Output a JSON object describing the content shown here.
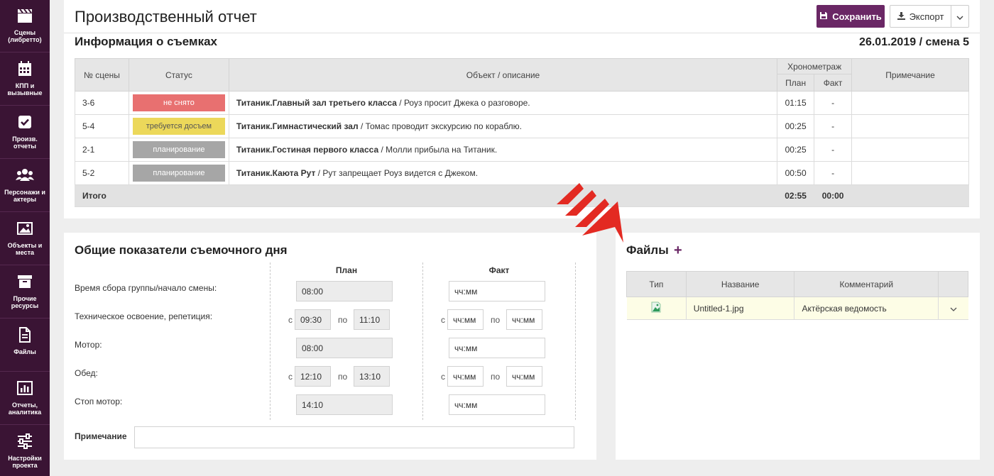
{
  "sidebar": {
    "items": [
      {
        "label": "Сцены\n(либретто)",
        "icon": "clapperboard-icon"
      },
      {
        "label": "КПП и\nвызывные",
        "icon": "calendar-icon"
      },
      {
        "label": "Произв.\nотчеты",
        "icon": "checkbox-icon"
      },
      {
        "label": "Персонажи и\nактеры",
        "icon": "users-icon"
      },
      {
        "label": "Объекты и\nместа",
        "icon": "image-icon"
      },
      {
        "label": "Прочие\nресурсы",
        "icon": "archive-icon"
      },
      {
        "label": "Файлы",
        "icon": "file-icon"
      },
      {
        "label": "Отчеты,\nаналитика",
        "icon": "bar-chart-icon"
      },
      {
        "label": "Настройки\nпроекта",
        "icon": "sliders-icon"
      }
    ]
  },
  "header": {
    "title": "Производственный отчет",
    "save_label": "Сохранить",
    "export_label": "Экспорт"
  },
  "shooting_info": {
    "title": "Информация о съемках",
    "date_shift": "26.01.2019 / смена 5",
    "columns": {
      "scene_no": "№ сцены",
      "status": "Статус",
      "object": "Объект / описание",
      "timing": "Хронометраж",
      "plan": "План",
      "fact": "Факт",
      "note": "Примечание"
    },
    "rows": [
      {
        "scene": "3-6",
        "status": "не снято",
        "status_color": "#e87070",
        "status_text_color": "#ffffff",
        "object": "Титаник.Главный зал третьего класса",
        "desc": " / Роуз просит Джека о разговоре.",
        "plan": "01:15",
        "fact": "-"
      },
      {
        "scene": "5-4",
        "status": "требуется досъем",
        "status_color": "#ecd85a",
        "status_text_color": "#555555",
        "object": "Титаник.Гимнастический зал",
        "desc": " / Томас проводит экскурсию по кораблю.",
        "plan": "00:25",
        "fact": "-"
      },
      {
        "scene": "2-1",
        "status": "планирование",
        "status_color": "#a6a6a6",
        "status_text_color": "#ffffff",
        "object": "Титаник.Гостиная первого класса",
        "desc": " / Молли прибыла на Титаник.",
        "plan": "00:25",
        "fact": "-"
      },
      {
        "scene": "5-2",
        "status": "планирование",
        "status_color": "#a6a6a6",
        "status_text_color": "#ffffff",
        "object": "Титаник.Каюта Рут",
        "desc": " / Рут запрещает Роуз видется с Джеком.",
        "plan": "00:50",
        "fact": "-"
      }
    ],
    "total": {
      "label": "Итого",
      "plan": "02:55",
      "fact": "00:00"
    }
  },
  "day_indicators": {
    "title": "Общие показатели съемочного дня",
    "plan_header": "План",
    "fact_header": "Факт",
    "from_label": "с",
    "to_label": "по",
    "placeholder": "чч:мм",
    "rows": [
      {
        "label": "Время сбора группы/начало смены:",
        "plan": "08:00"
      },
      {
        "label": "Техническое освоение, репетиция:",
        "plan_from": "09:30",
        "plan_to": "11:10"
      },
      {
        "label": "Мотор:",
        "plan": "08:00"
      },
      {
        "label": "Обед:",
        "plan_from": "12:10",
        "plan_to": "13:10"
      },
      {
        "label": "Стоп мотор:",
        "plan": "14:10"
      }
    ],
    "note_label": "Примечание"
  },
  "files": {
    "title": "Файлы",
    "add_label": "+",
    "columns": {
      "type": "Тип",
      "name": "Название",
      "comment": "Комментарий"
    },
    "rows": [
      {
        "type_icon": "image-file-icon",
        "name": "Untitled-1.jpg",
        "comment": "Актёрская ведомость"
      }
    ]
  },
  "colors": {
    "sidebar_bg": "#3a1434",
    "accent": "#6a2765",
    "arrow": "#e32a22"
  }
}
